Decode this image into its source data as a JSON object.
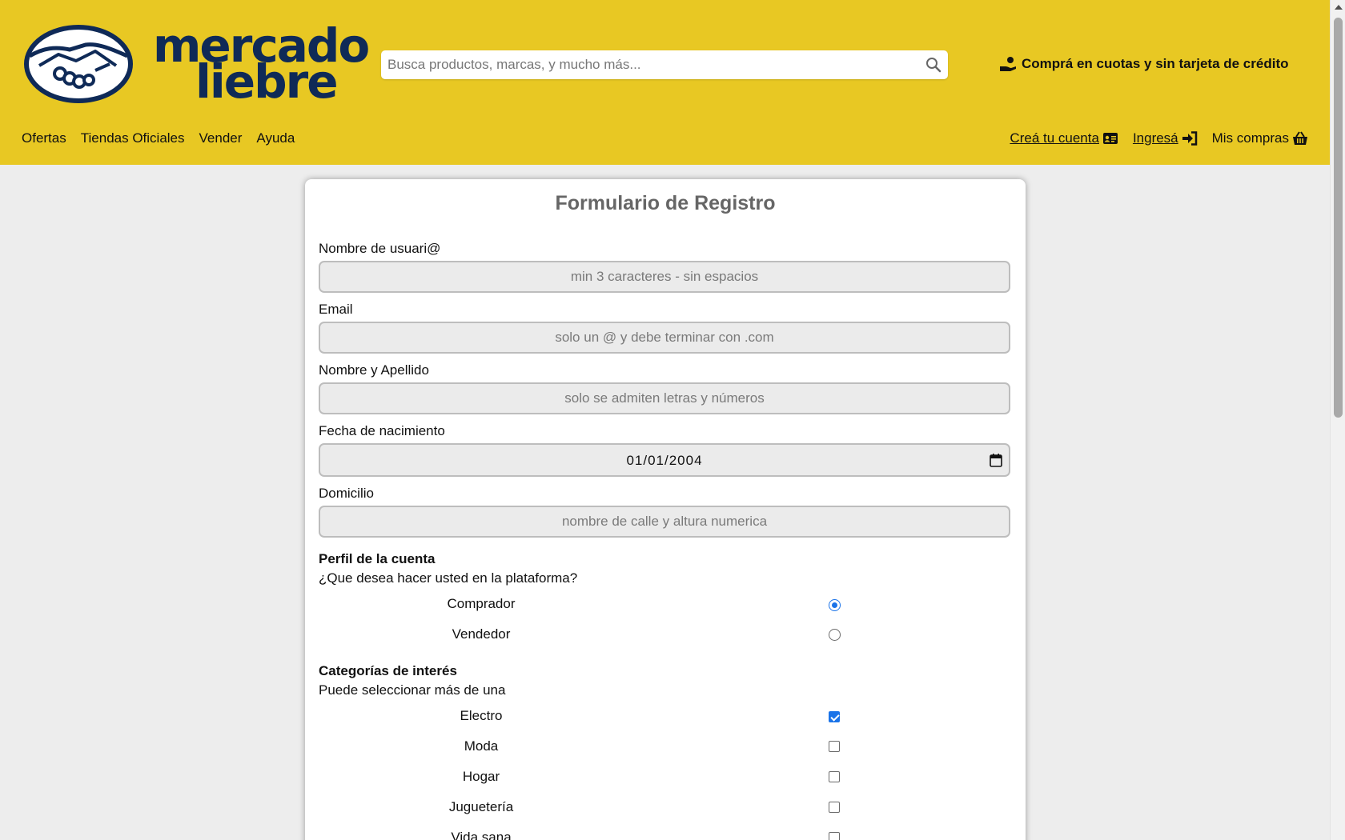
{
  "header": {
    "logo": {
      "line1": "mercado",
      "line2": "liebre"
    },
    "search": {
      "placeholder": "Busca productos, marcas, y mucho más...",
      "icon": "search-icon"
    },
    "promo": {
      "text": "Comprá en cuotas y sin tarjeta de crédito",
      "icon": "hand-coin-icon"
    },
    "nav_left": [
      "Ofertas",
      "Tiendas Oficiales",
      "Vender",
      "Ayuda"
    ],
    "nav_right": {
      "create_account": "Creá tu cuenta",
      "create_account_icon": "id-card-icon",
      "login": "Ingresá",
      "login_icon": "sign-in-icon",
      "purchases": "Mis compras",
      "purchases_icon": "basket-icon"
    }
  },
  "form": {
    "title": "Formulario de Registro",
    "fields": {
      "username": {
        "label": "Nombre de usuari@",
        "placeholder": "min 3 caracteres - sin espacios"
      },
      "email": {
        "label": "Email",
        "placeholder": "solo un @ y debe terminar con .com"
      },
      "fullname": {
        "label": "Nombre y Apellido",
        "placeholder": "solo se admiten letras y números"
      },
      "birthdate": {
        "label": "Fecha de nacimiento",
        "value": "01/01/2004"
      },
      "address": {
        "label": "Domicilio",
        "placeholder": "nombre de calle y altura numerica"
      }
    },
    "profile": {
      "title": "Perfil de la cuenta",
      "question": "¿Que desea hacer usted en la plataforma?",
      "options": [
        {
          "label": "Comprador",
          "checked": true
        },
        {
          "label": "Vendedor",
          "checked": false
        }
      ]
    },
    "categories": {
      "title": "Categorías de interés",
      "hint": "Puede seleccionar más de una",
      "options": [
        {
          "label": "Electro",
          "checked": true
        },
        {
          "label": "Moda",
          "checked": false
        },
        {
          "label": "Hogar",
          "checked": false
        },
        {
          "label": "Juguetería",
          "checked": false
        },
        {
          "label": "Vida sana",
          "checked": false
        }
      ]
    }
  },
  "colors": {
    "header_bg": "#e8c823",
    "logo_navy": "#0f2a57",
    "accent_blue": "#1a73e8",
    "page_bg": "#ededed"
  }
}
